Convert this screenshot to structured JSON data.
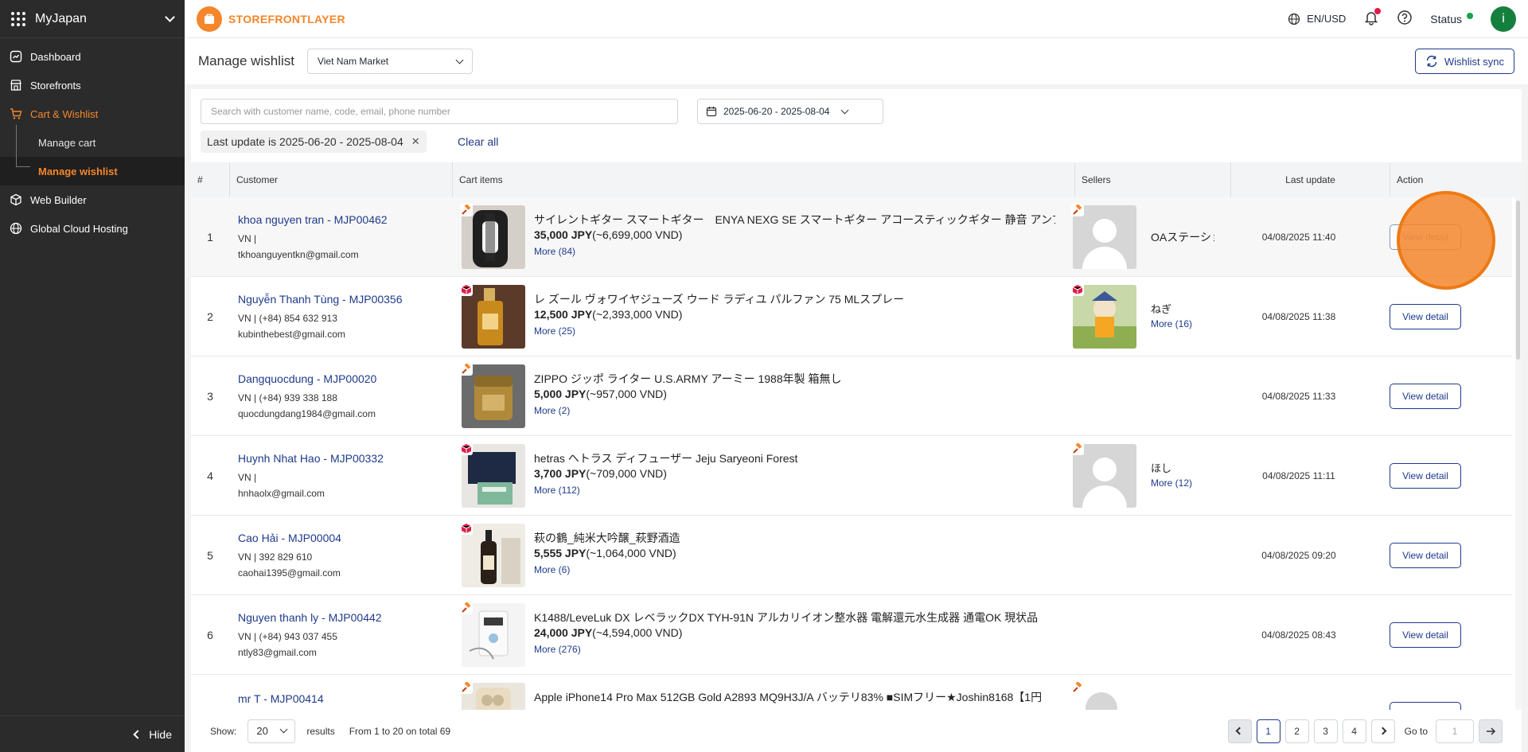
{
  "sidebar": {
    "title": "MyJapan",
    "items": [
      {
        "label": "Dashboard",
        "icon": "dashboard-icon"
      },
      {
        "label": "Storefronts",
        "icon": "store-icon"
      },
      {
        "label": "Cart & Wishlist",
        "icon": "cart-icon"
      },
      {
        "label": "Manage cart"
      },
      {
        "label": "Manage wishlist"
      },
      {
        "label": "Web Builder",
        "icon": "cube-icon"
      },
      {
        "label": "Global Cloud Hosting",
        "icon": "globe-icon"
      }
    ],
    "hide_label": "Hide"
  },
  "topbar": {
    "brand": "STOREFRONTLAYER",
    "lang": "EN/USD",
    "status": "Status",
    "avatar_letter": "i"
  },
  "header": {
    "title": "Manage wishlist",
    "market": "Viet Nam Market",
    "sync_label": "Wishlist sync"
  },
  "filters": {
    "search_placeholder": "Search with customer name, code, email, phone number",
    "date_range": "2025-06-20 - 2025-08-04",
    "chip": "Last update is 2025-06-20 - 2025-08-04",
    "clear_all": "Clear all"
  },
  "table": {
    "columns": [
      "#",
      "Customer",
      "Cart items",
      "Sellers",
      "Last update",
      "Action"
    ],
    "action_label": "View detail",
    "rows": [
      {
        "idx": "1",
        "name": "khoa nguyen tran - MJP00462",
        "meta": "VN |",
        "email": "tkhoanguyentkn@gmail.com",
        "title": "サイレントギター スマートギター　ENYA NEXG SE スマートギター アコースティックギター 静音 アンプ",
        "price": "35,000 JPY",
        "price_vnd": "(~6,699,000 VND)",
        "more": "More (84)",
        "seller": "OAステーショ",
        "seller_more": "",
        "update": "04/08/2025 11:40"
      },
      {
        "idx": "2",
        "name": "Nguyễn Thanh Tùng - MJP00356",
        "meta": "VN | (+84) 854 632 913",
        "email": "kubinthebest@gmail.com",
        "title": "レ ズール ヴォワイヤジューズ ウード ラディユ パルファン 75 MLスプレー",
        "price": "12,500 JPY",
        "price_vnd": "(~2,393,000 VND)",
        "more": "More (25)",
        "seller": "ねぎ",
        "seller_more": "More (16)",
        "update": "04/08/2025 11:38"
      },
      {
        "idx": "3",
        "name": "Dangquocdung - MJP00020",
        "meta": "VN | (+84) 939 338 188",
        "email": "quocdungdang1984@gmail.com",
        "title": "ZIPPO ジッポ ライター U.S.ARMY アーミー 1988年製 箱無し",
        "price": "5,000 JPY",
        "price_vnd": "(~957,000 VND)",
        "more": "More (2)",
        "seller": "",
        "seller_more": "",
        "update": "04/08/2025 11:33"
      },
      {
        "idx": "4",
        "name": "Huynh Nhat Hao - MJP00332",
        "meta": "VN |",
        "email": "hnhaolx@gmail.com",
        "title": "hetras ヘトラス ディフューザー Jeju Saryeoni Forest",
        "price": "3,700 JPY",
        "price_vnd": "(~709,000 VND)",
        "more": "More (112)",
        "seller": "ほし",
        "seller_more": "More (12)",
        "update": "04/08/2025 11:11"
      },
      {
        "idx": "5",
        "name": "Cao Hải - MJP00004",
        "meta": "VN | 392 829 610",
        "email": "caohai1395@gmail.com",
        "title": "萩の鶴_純米大吟醸_萩野酒造",
        "price": "5,555 JPY",
        "price_vnd": "(~1,064,000 VND)",
        "more": "More (6)",
        "seller": "",
        "seller_more": "",
        "update": "04/08/2025 09:20"
      },
      {
        "idx": "6",
        "name": "Nguyen thanh ly - MJP00442",
        "meta": "VN | (+84) 943 037 455",
        "email": "ntly83@gmail.com",
        "title": "K1488/LeveLuk DX レベラックDX TYH-91N アルカリイオン整水器 電解還元水生成器 通電OK 現状品",
        "price": "24,000 JPY",
        "price_vnd": "(~4,594,000 VND)",
        "more": "More (276)",
        "seller": "",
        "seller_more": "",
        "update": "04/08/2025 08:43"
      },
      {
        "idx": "",
        "name": "mr T - MJP00414",
        "meta": "",
        "email": "",
        "title": "Apple iPhone14 Pro Max 512GB Gold A2893 MQ9H3J/A バッテリ83% ■SIMフリー★Joshin8168【1円",
        "price": "",
        "price_vnd": "",
        "more": "",
        "seller": "",
        "seller_more": "",
        "update": ""
      }
    ]
  },
  "footer": {
    "show_label": "Show:",
    "page_size": "20",
    "results_label": "results",
    "range_text": "From 1 to 20 on total 69",
    "pages": [
      "1",
      "2",
      "3",
      "4"
    ],
    "goto_label": "Go to",
    "goto_placeholder": "1"
  },
  "colors": {
    "accent": "#f5862b",
    "primary": "#1e3a8a",
    "sidebar": "#2b2b2b"
  }
}
